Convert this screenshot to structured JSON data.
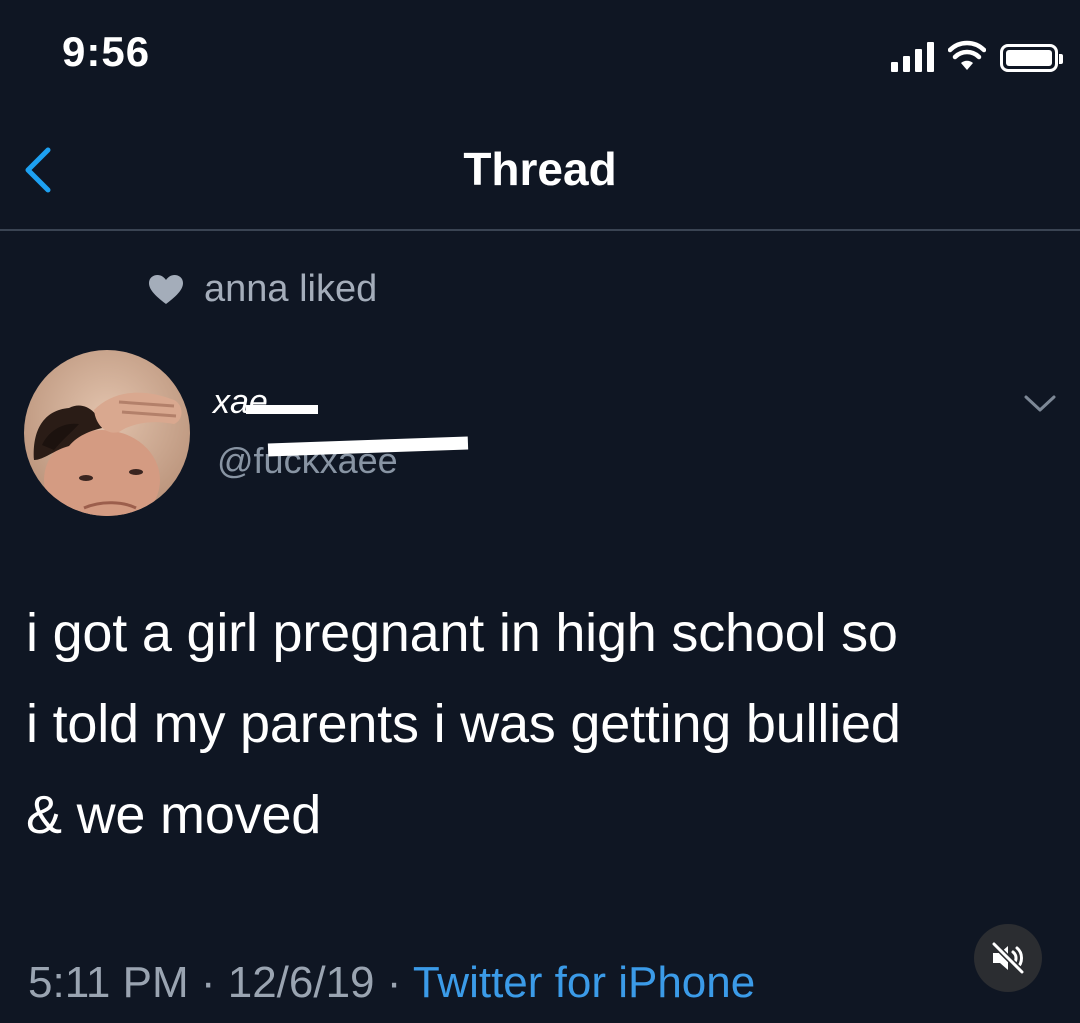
{
  "status_bar": {
    "time": "9:56"
  },
  "nav": {
    "title": "Thread",
    "back_icon": "chevron-left-icon"
  },
  "social_context": {
    "icon": "heart-icon",
    "text": "anna liked"
  },
  "author": {
    "name": "xae",
    "handle": "@fuckxaee"
  },
  "tweet": {
    "line1": "i got a girl pregnant in high school so",
    "line2": "i told my parents i was getting bullied",
    "line3": "& we moved"
  },
  "meta": {
    "time": "5:11 PM",
    "separator": " · ",
    "date": "12/6/19",
    "source": "Twitter for iPhone"
  },
  "colors": {
    "background": "#0f1623",
    "accent": "#1da1f2",
    "secondary_text": "#9aa4b1"
  }
}
